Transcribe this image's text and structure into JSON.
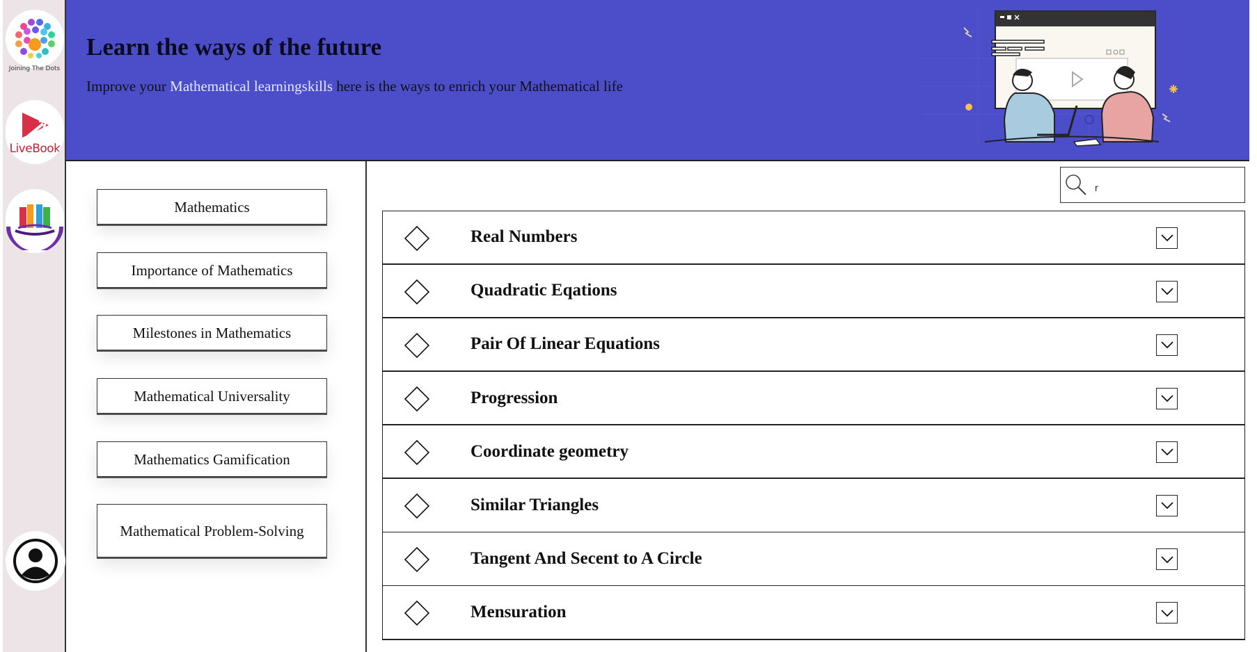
{
  "rail": {
    "logo_caption": "Joining The Dots",
    "livebook_label": "LiveBook"
  },
  "header": {
    "title": "Learn the ways of the future",
    "subtitle_prefix": "Improve your ",
    "subtitle_highlight": "Mathematical learningskills",
    "subtitle_suffix": " here is the ways to enrich your Mathematical life"
  },
  "sidebar": {
    "items": [
      {
        "label": "Mathematics"
      },
      {
        "label": "Importance of Mathematics"
      },
      {
        "label": "Milestones in Mathematics"
      },
      {
        "label": "Mathematical Universality"
      },
      {
        "label": "Mathematics Gamification"
      },
      {
        "label": "Mathematical Problem-Solving"
      }
    ]
  },
  "search": {
    "value": "r"
  },
  "chapters": [
    {
      "title": "Real Numbers"
    },
    {
      "title": "Quadratic Eqations"
    },
    {
      "title": "Pair Of Linear Equations"
    },
    {
      "title": "Progression"
    },
    {
      "title": "Coordinate geometry"
    },
    {
      "title": "Similar Triangles"
    },
    {
      "title": "Tangent And Secent to A Circle"
    },
    {
      "title": "Mensuration"
    }
  ],
  "colors": {
    "banner": "#4b4dc9",
    "rail": "#ece4e6",
    "highlight": "#e6e8ff",
    "livebook": "#c2233b"
  }
}
